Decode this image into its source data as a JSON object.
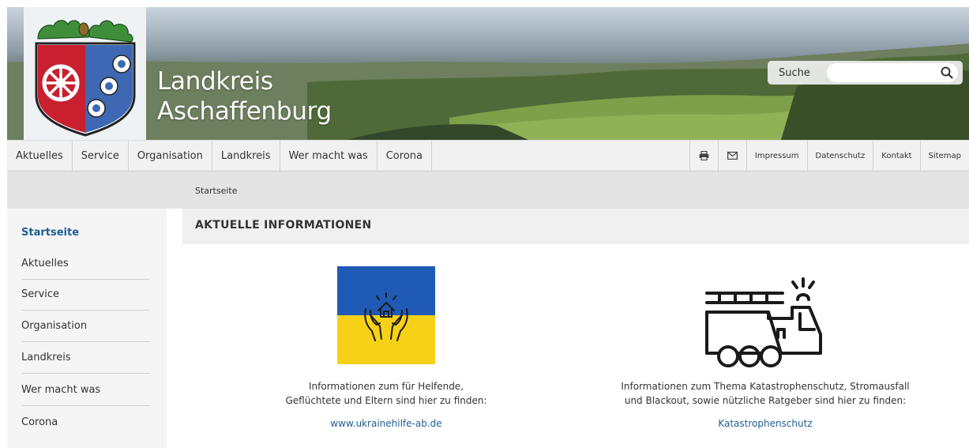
{
  "header": {
    "title_line1": "Landkreis",
    "title_line2": "Aschaffenburg",
    "search_label": "Suche",
    "search_value": "",
    "search_placeholder": ""
  },
  "nav": {
    "items": [
      "Aktuelles",
      "Service",
      "Organisation",
      "Landkreis",
      "Wer macht was",
      "Corona"
    ],
    "icons": [
      "print-icon",
      "mail-icon"
    ],
    "utility": [
      "Impressum",
      "Datenschutz",
      "Kontakt",
      "Sitemap"
    ]
  },
  "breadcrumb": {
    "current": "Startseite"
  },
  "sidebar": {
    "items": [
      "Startseite",
      "Aktuelles",
      "Service",
      "Organisation",
      "Landkreis",
      "Wer macht was",
      "Corona"
    ],
    "active_index": 0
  },
  "main": {
    "title": "AKTUELLE INFORMATIONEN",
    "cards": [
      {
        "icon": "ukraine-help-icon",
        "text_line1": "Informationen zum für Helfende,",
        "text_line2": "Geflüchtete und Eltern sind hier zu finden:",
        "link": "www.ukrainehilfe-ab.de"
      },
      {
        "icon": "fire-truck-icon",
        "text_line1": "Informationen zum Thema Katastrophenschutz, Stromausfall",
        "text_line2": "und Blackout, sowie nützliche Ratgeber sind hier zu finden:",
        "link": "Katastrophenschutz"
      }
    ]
  },
  "colors": {
    "accent_link": "#1f5e94",
    "ukraine_blue": "#1f5bb6",
    "ukraine_yellow": "#f7d117",
    "nav_bg": "#f1f1f1",
    "breadcrumb_bg": "#e4e4e4"
  }
}
